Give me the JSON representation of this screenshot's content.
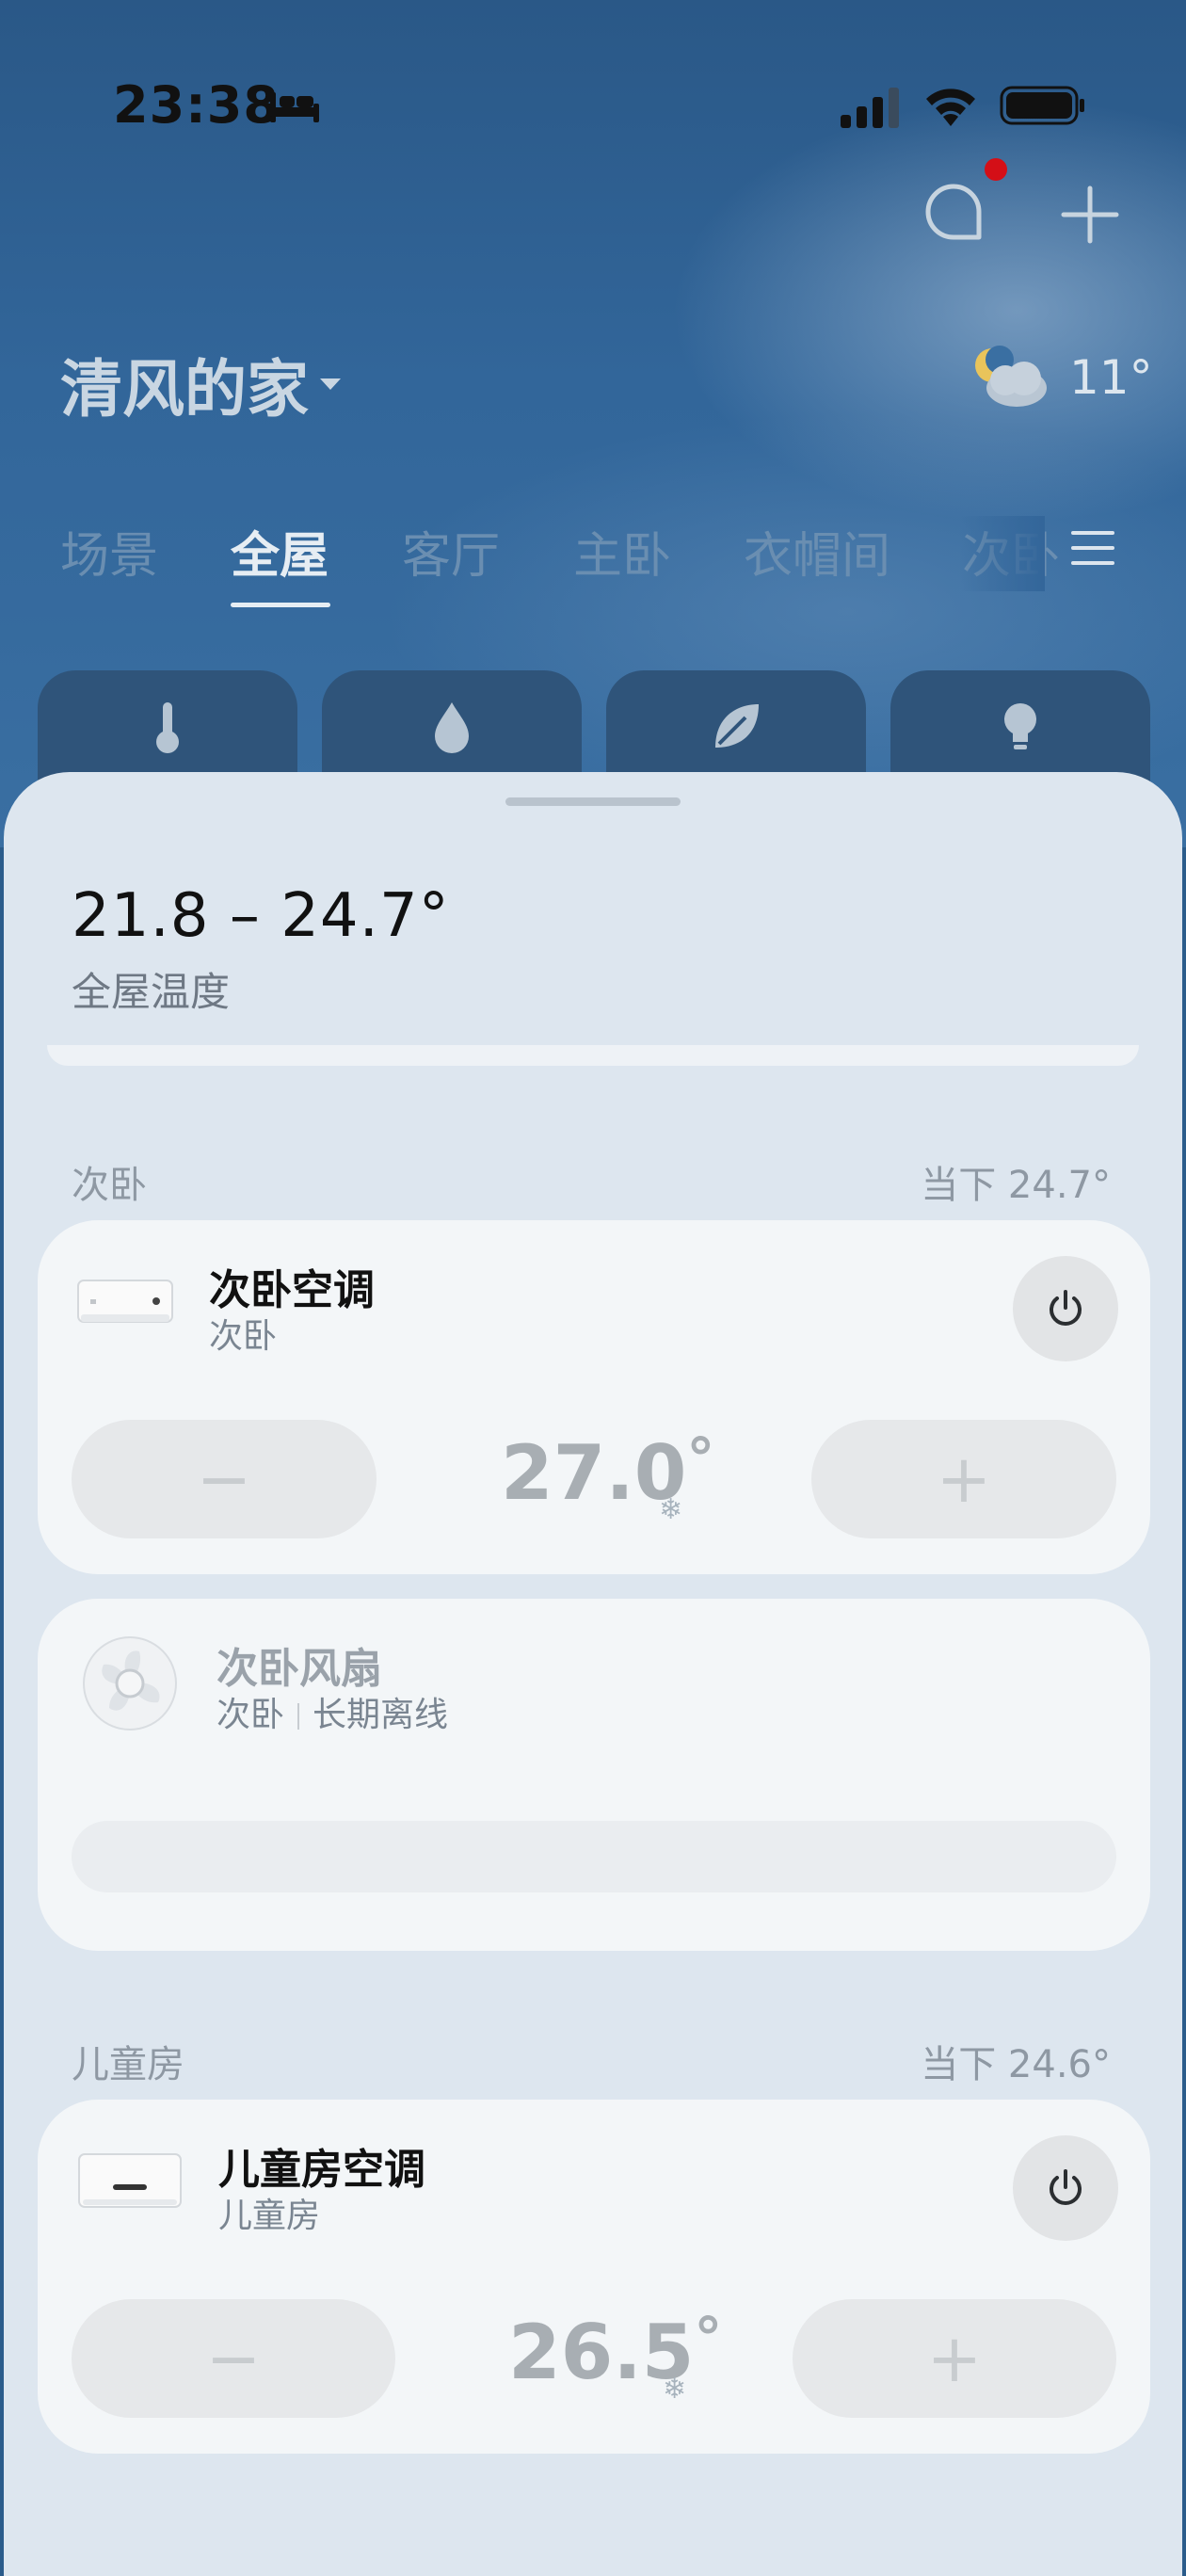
{
  "status_bar": {
    "time": "23:38"
  },
  "header": {
    "home_title": "清风的家",
    "weather_temp": "11°"
  },
  "tabs": [
    "场景",
    "全屋",
    "客厅",
    "主卧",
    "衣帽间",
    "次卧"
  ],
  "active_tab": "全屋",
  "quick_filters": [
    "temperature",
    "humidity",
    "air",
    "light"
  ],
  "summary": {
    "range": "21.8 – 24.7°",
    "label": "全屋温度"
  },
  "rooms": [
    {
      "name": "次卧",
      "current": "当下 24.7°",
      "devices": [
        {
          "name": "次卧空调",
          "room": "次卧",
          "setpoint": "27.0",
          "mode_icon": "snowflake",
          "minus": "−",
          "plus": "+"
        },
        {
          "name": "次卧风扇",
          "room": "次卧",
          "status": "长期离线"
        }
      ]
    },
    {
      "name": "儿童房",
      "current": "当下 24.6°",
      "devices": [
        {
          "name": "儿童房空调",
          "room": "儿童房",
          "setpoint": "26.5",
          "mode_icon": "snowflake",
          "minus": "−",
          "plus": "+"
        }
      ]
    }
  ],
  "colors": {
    "sky_top": "#2a5887",
    "sheet": "#dde6ef",
    "card": "#f3f6f8",
    "notification_dot": "#d40f17"
  }
}
